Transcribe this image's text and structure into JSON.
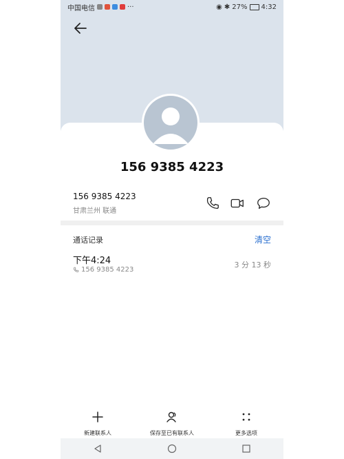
{
  "status_bar": {
    "carrier": "中国电信",
    "battery": "27%",
    "time": "4:32"
  },
  "contact": {
    "display_number": "156 9385 4223",
    "number": "156 9385 4223",
    "location": "甘肃兰州 联通"
  },
  "call_log": {
    "title": "通话记录",
    "clear_label": "清空",
    "entries": [
      {
        "time": "下午4:24",
        "number": "156 9385 4223",
        "duration": "3 分 13 秒"
      }
    ]
  },
  "bottom_actions": {
    "new_contact": "新建联系人",
    "save_existing": "保存至已有联系人",
    "more": "更多选项"
  },
  "icons": {
    "back": "back-arrow-icon",
    "call": "phone-icon",
    "video": "video-call-icon",
    "message": "message-icon"
  },
  "colors": {
    "accent": "#2a6fcf",
    "header_bg": "#dbe3ec"
  }
}
